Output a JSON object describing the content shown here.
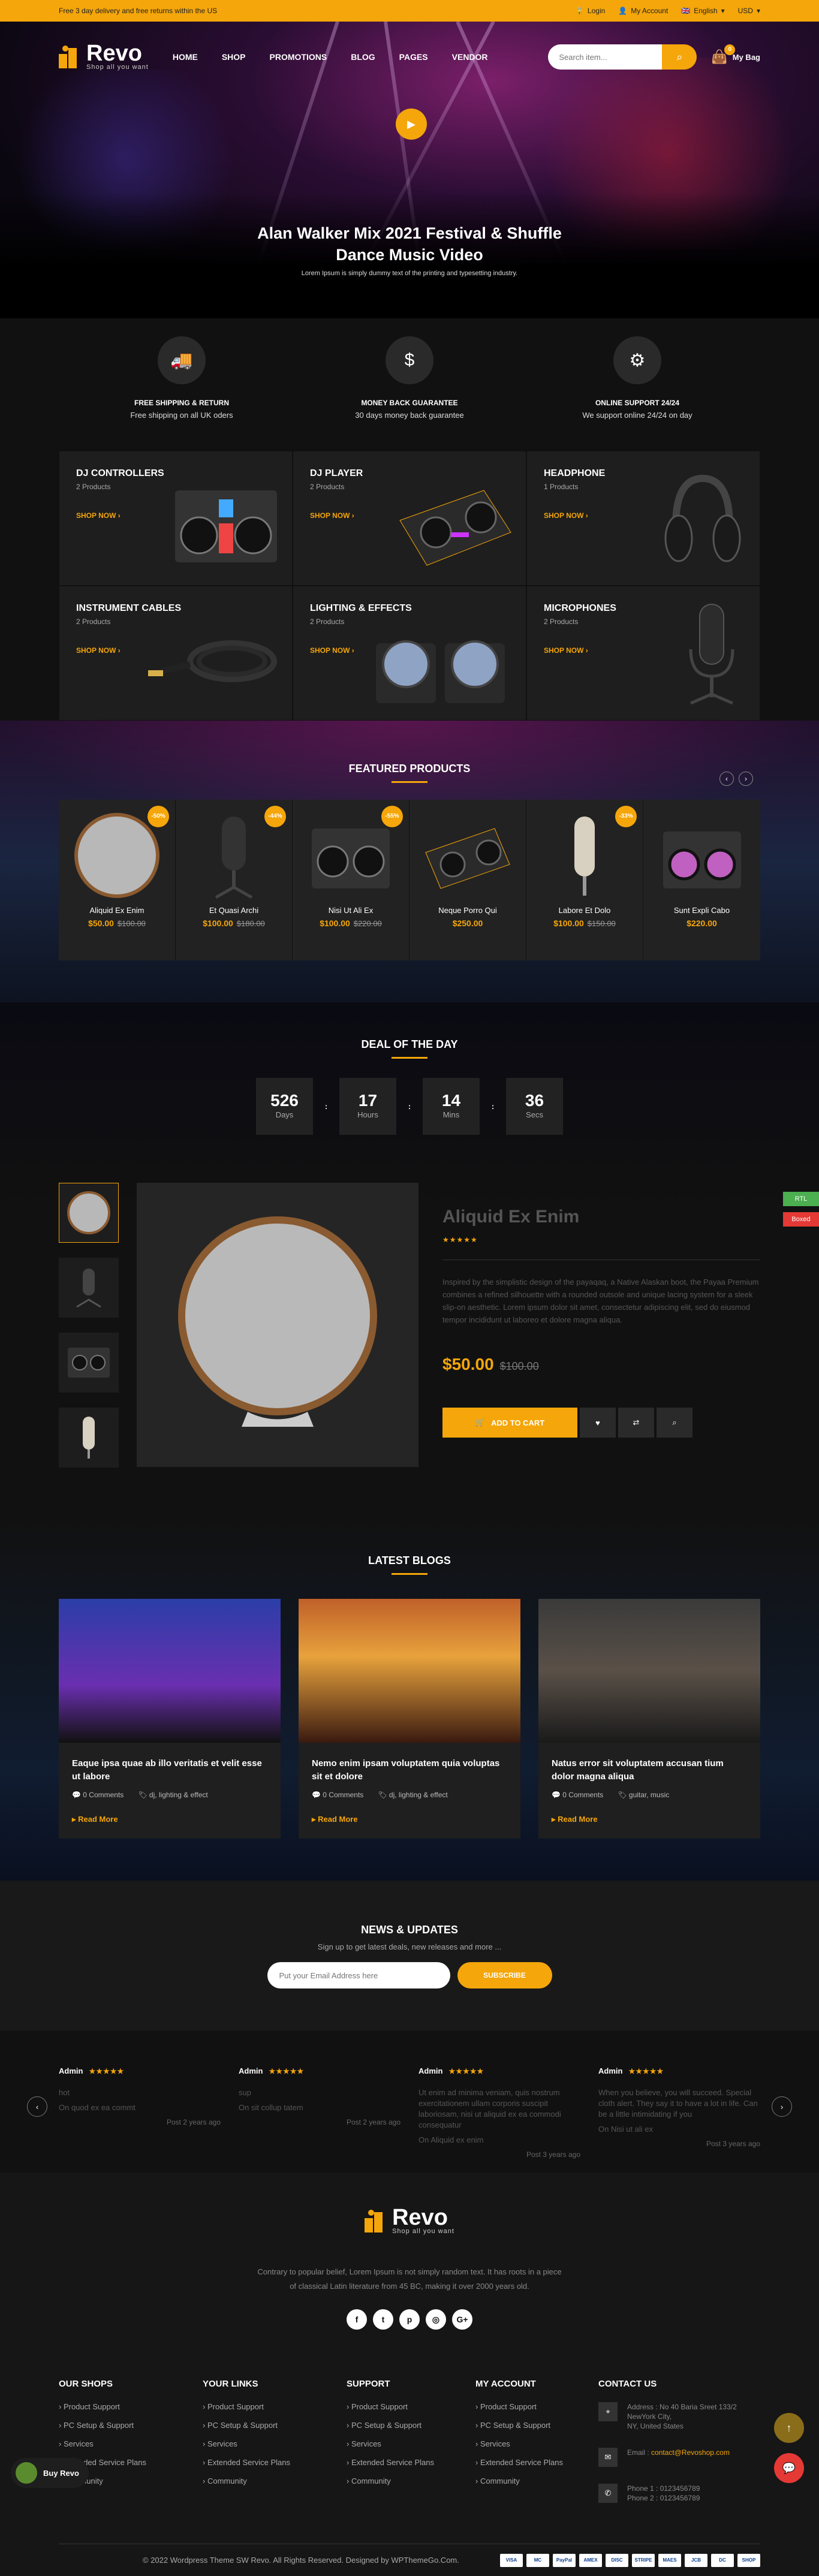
{
  "topbar": {
    "promo": "Free 3 day delivery and free returns within the US",
    "login": "Login",
    "account": "My Account",
    "language": "English",
    "currency": "USD"
  },
  "header": {
    "logo_name": "Revo",
    "logo_tag": "Shop all you want",
    "nav": [
      "HOME",
      "SHOP",
      "PROMOTIONS",
      "BLOG",
      "PAGES",
      "VENDOR"
    ],
    "search_placeholder": "Search item...",
    "cart_count": "0",
    "cart_label": "My Bag"
  },
  "hero": {
    "title_line1": "Alan Walker Mix 2021 Festival & Shuffle",
    "title_line2": "Dance Music Video",
    "subtitle": "Lorem Ipsum is simply dummy text of the printing and typesetting industry."
  },
  "features": [
    {
      "title": "FREE SHIPPING & RETURN",
      "text": "Free shipping on all UK oders",
      "icon": "truck-icon"
    },
    {
      "title": "MONEY BACK GUARANTEE",
      "text": "30 days money back guarantee",
      "icon": "money-icon"
    },
    {
      "title": "ONLINE SUPPORT 24/24",
      "text": "We support online 24/24 on day",
      "icon": "gears-icon"
    }
  ],
  "categories": [
    {
      "name": "DJ CONTROLLERS",
      "count": "2 Products",
      "cta": "SHOP NOW"
    },
    {
      "name": "DJ PLAYER",
      "count": "2 Products",
      "cta": "SHOP NOW"
    },
    {
      "name": "HEADPHONE",
      "count": "1 Products",
      "cta": "SHOP NOW"
    },
    {
      "name": "INSTRUMENT CABLES",
      "count": "2 Products",
      "cta": "SHOP NOW"
    },
    {
      "name": "LIGHTING & EFFECTS",
      "count": "2 Products",
      "cta": "SHOP NOW"
    },
    {
      "name": "MICROPHONES",
      "count": "2 Products",
      "cta": "SHOP NOW"
    }
  ],
  "featured": {
    "title": "FEATURED PRODUCTS",
    "products": [
      {
        "name": "Aliquid Ex Enim",
        "price": "$50.00",
        "old": "$100.00",
        "sale": "-50%"
      },
      {
        "name": "Et Quasi Archi",
        "price": "$100.00",
        "old": "$180.00",
        "sale": "-44%"
      },
      {
        "name": "Nisi Ut Ali Ex",
        "price": "$100.00",
        "old": "$220.00",
        "sale": "-55%"
      },
      {
        "name": "Neque Porro Qui",
        "price": "$250.00",
        "old": "",
        "sale": ""
      },
      {
        "name": "Labore Et Dolo",
        "price": "$100.00",
        "old": "$150.00",
        "sale": "-33%"
      },
      {
        "name": "Sunt Expli Cabo",
        "price": "$220.00",
        "old": "",
        "sale": ""
      }
    ]
  },
  "deal": {
    "title": "DEAL OF THE DAY",
    "countdown": [
      {
        "value": "526",
        "unit": "Days"
      },
      {
        "value": "17",
        "unit": "Hours"
      },
      {
        "value": "14",
        "unit": "Mins"
      },
      {
        "value": "36",
        "unit": "Secs"
      }
    ],
    "product_name": "Aliquid Ex Enim",
    "description": "Inspired by the simplistic design of the payaqaq, a Native Alaskan boot, the Payaa Premium combines a refined silhouette with a rounded outsole and unique lacing system for a sleek slip-on aesthetic. Lorem ipsum dolor sit amet, consectetur adipiscing elit, sed do eiusmod tempor incididunt ut laboreo et dolore magna aliqua.",
    "price": "$50.00",
    "old_price": "$100.00",
    "add_to_cart": "ADD TO CART"
  },
  "blogs": {
    "title": "LATEST BLOGS",
    "items": [
      {
        "title": "Eaque ipsa quae ab illo veritatis et velit esse ut labore",
        "comments": "0 Comments",
        "tags": "dj, lighting & effect",
        "more": "Read More"
      },
      {
        "title": "Nemo enim ipsam voluptatem quia voluptas sit et dolore",
        "comments": "0 Comments",
        "tags": "dj, lighting & effect",
        "more": "Read More"
      },
      {
        "title": "Natus error sit voluptatem accusan tium dolor magna aliqua",
        "comments": "0 Comments",
        "tags": "guitar, music",
        "more": "Read More"
      }
    ]
  },
  "news": {
    "title": "NEWS & UPDATES",
    "text": "Sign up to get latest deals, new releases and more ...",
    "placeholder": "Put your Email Address here",
    "button": "SUBSCRIBE"
  },
  "testimonials": [
    {
      "author": "Admin",
      "line1": "hot",
      "line2": "On quod ex ea commt",
      "date": "Post 2 years ago"
    },
    {
      "author": "Admin",
      "line1": "sup",
      "line2": "On sit collup tatem",
      "date": "Post 2 years ago"
    },
    {
      "author": "Admin",
      "line1": "Ut enim ad minima veniam, quis nostrum exercitationem ullam corporis suscipit laboriosam, nisi ut aliquid ex ea commodi consequatur",
      "line2": "On Aliquid ex enim",
      "date": "Post 3 years ago"
    },
    {
      "author": "Admin",
      "line1": "When you believe, you will succeed. Special cloth alert. They say it to have a lot in life. Can be a little intimidating if you",
      "line2": "On Nisi ut ali ex",
      "date": "Post 3 years ago"
    }
  ],
  "footer": {
    "description_line1": "Contrary to popular belief, Lorem Ipsum is not simply random text. It has roots in a piece",
    "description_line2": "of classical Latin literature from 45 BC, making it over 2000 years old.",
    "columns": [
      {
        "title": "OUR SHOPS",
        "links": [
          "Product Support",
          "PC Setup & Support",
          "Services",
          "Extended Service Plans",
          "Community"
        ]
      },
      {
        "title": "YOUR LINKS",
        "links": [
          "Product Support",
          "PC Setup & Support",
          "Services",
          "Extended Service Plans",
          "Community"
        ]
      },
      {
        "title": "SUPPORT",
        "links": [
          "Product Support",
          "PC Setup & Support",
          "Services",
          "Extended Service Plans",
          "Community"
        ]
      },
      {
        "title": "MY ACCOUNT",
        "links": [
          "Product Support",
          "PC Setup & Support",
          "Services",
          "Extended Service Plans",
          "Community"
        ]
      }
    ],
    "contact": {
      "title": "CONTACT US",
      "address_l1": "Address : No 40 Baria Sreet 133/2",
      "address_l2": "NewYork City,",
      "address_l3": "NY, United States",
      "email_label": "Email :",
      "email": "contact@Revoshop.com",
      "phone1": "Phone 1 : 0123456789",
      "phone2": "Phone 2 : 0123456789"
    },
    "copyright": "© 2022 Wordpress Theme SW Revo. All Rights Reserved. Designed by WPThemeGo.Com.",
    "payments": [
      "VISA",
      "MC",
      "PayPal",
      "AMEX",
      "DISC",
      "STRIPE",
      "MAES",
      "JCB",
      "DC",
      "SHOP"
    ]
  },
  "widgets": {
    "rtl": "RTL",
    "boxed": "Boxed",
    "buy": "Buy Revo"
  }
}
